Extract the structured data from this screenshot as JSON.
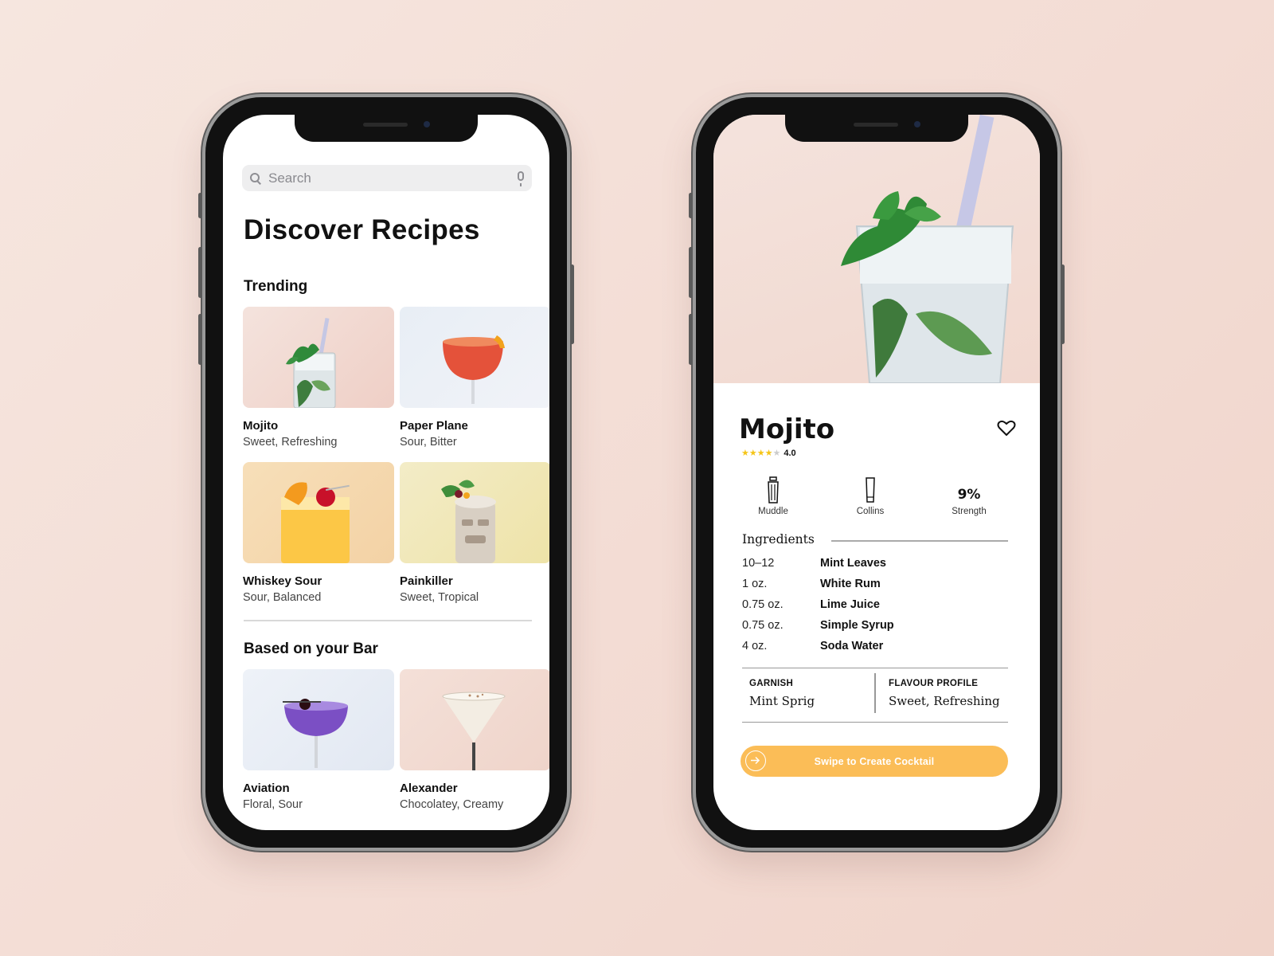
{
  "discover": {
    "search_placeholder": "Search",
    "title": "Discover Recipes",
    "trending_heading": "Trending",
    "trending": [
      {
        "name": "Mojito",
        "tags": "Sweet, Refreshing"
      },
      {
        "name": "Paper Plane",
        "tags": "Sour, Bitter"
      },
      {
        "name": "Whiskey Sour",
        "tags": "Sour, Balanced"
      },
      {
        "name": "Painkiller",
        "tags": "Sweet, Tropical"
      }
    ],
    "bar_heading": "Based on your Bar",
    "bar": [
      {
        "name": "Aviation",
        "tags": "Floral, Sour"
      },
      {
        "name": "Alexander",
        "tags": "Chocolatey, Creamy"
      }
    ]
  },
  "detail": {
    "title": "Mojito",
    "rating": {
      "value": 4.0,
      "label": "4.0",
      "max": 5
    },
    "stats": [
      {
        "label": "Muddle",
        "icon": "shaker-icon"
      },
      {
        "label": "Collins",
        "icon": "collins-glass-icon"
      },
      {
        "value": "9%",
        "label": "Strength"
      }
    ],
    "ingredients_heading": "Ingredients",
    "ingredients": [
      {
        "qty": "10–12",
        "name": "Mint Leaves"
      },
      {
        "qty": "1 oz.",
        "name": "White Rum"
      },
      {
        "qty": "0.75 oz.",
        "name": "Lime Juice"
      },
      {
        "qty": "0.75 oz.",
        "name": "Simple Syrup"
      },
      {
        "qty": "4 oz.",
        "name": "Soda Water"
      }
    ],
    "garnish_label": "GARNISH",
    "garnish_value": "Mint Sprig",
    "flavour_label": "FLAVOUR PROFILE",
    "flavour_value": "Sweet, Refreshing",
    "cta_label": "Swipe to Create Cocktail"
  },
  "colors": {
    "accent": "#fbbd57",
    "star_filled": "#f5c518",
    "star_empty": "#cccccc"
  }
}
